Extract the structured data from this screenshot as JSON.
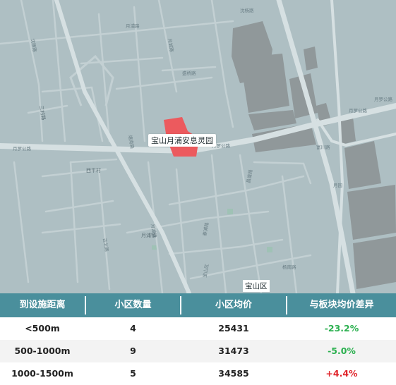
{
  "map": {
    "poi_label": "宝山月浦安息灵园",
    "district_label": "宝山区",
    "road_labels": {
      "yueluo_left": "月罗公路",
      "yueluo_mid": "月罗公路",
      "yueluo_right": "月罗公路",
      "top_road": "月浦路",
      "upper_left": "沈杨路",
      "top_mid": "沈杨路",
      "left_vertical": "塘南路",
      "mid_road": "月城路",
      "left_place": "三村路",
      "yanshi": "西平村",
      "ring": "盛桥路",
      "right_vertical": "富川路",
      "right_small": "月园",
      "lower_mid": "春浦路",
      "lower_mid2": "昌盛路",
      "lower_left": "月浦镇",
      "lower_left2": "古北路",
      "lower_center": "月浦镇",
      "lower_right": "杨南路",
      "bottom_center": "宝山区",
      "right_top": "月罗公路"
    },
    "colors": {
      "land": "#aebfc3",
      "road": "#cbd7da",
      "major_road": "#d6e0e2",
      "building": "#8d9496",
      "poi": "#ec5a5e",
      "park": "#9fc2b5"
    }
  },
  "table": {
    "headers": [
      "到设施距离",
      "小区数量",
      "小区均价",
      "与板块均价差异"
    ],
    "rows": [
      {
        "distance": "<500m",
        "count": "4",
        "price": "25431",
        "diff": "-23.2%",
        "trend": "down"
      },
      {
        "distance": "500-1000m",
        "count": "9",
        "price": "31473",
        "diff": "-5.0%",
        "trend": "down"
      },
      {
        "distance": "1000-1500m",
        "count": "5",
        "price": "34585",
        "diff": "+4.4%",
        "trend": "up"
      }
    ],
    "colors": {
      "header_bg": "#4a8f9c",
      "negative": "#2bb04f",
      "positive": "#e0262c"
    }
  }
}
